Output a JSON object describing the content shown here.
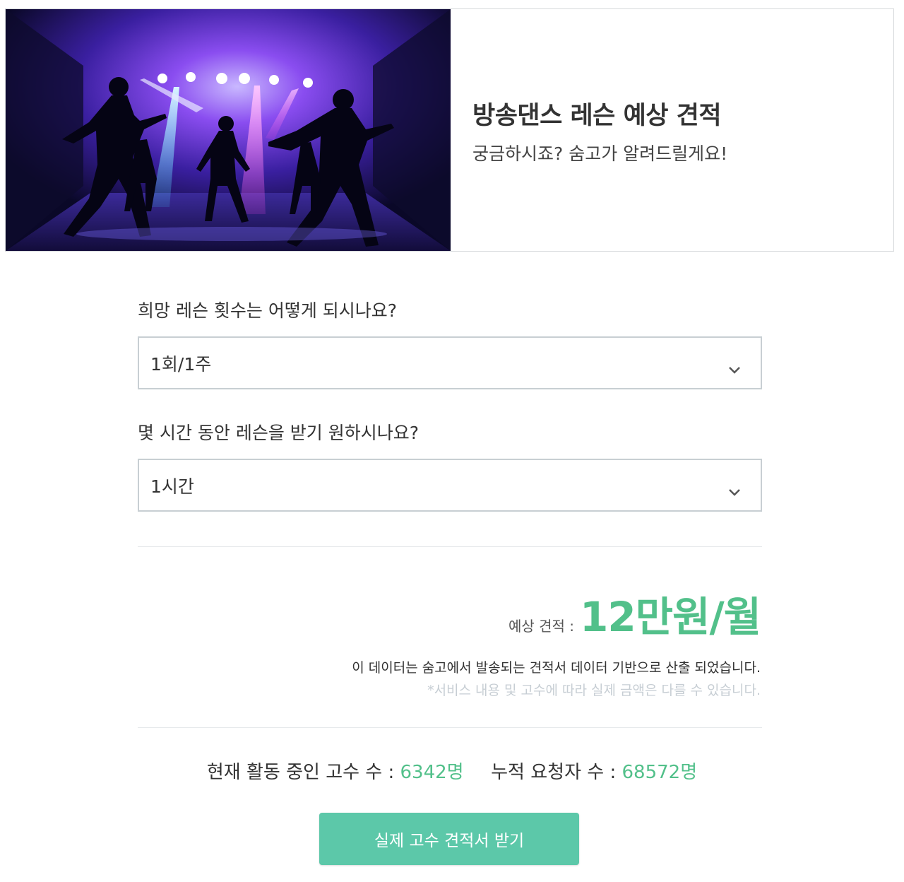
{
  "hero": {
    "title": "방송댄스 레슨 예상 견적",
    "subtitle": "궁금하시죠? 숨고가 알려드릴게요!"
  },
  "questions": [
    {
      "label": "희망 레슨 횟수는 어떻게 되시나요?",
      "selected": "1회/1주"
    },
    {
      "label": "몇 시간 동안 레슨을 받기 원하시나요?",
      "selected": "1시간"
    }
  ],
  "estimate": {
    "label": "예상 견적 :",
    "value": "12만원/월"
  },
  "notes": {
    "source": "이 데이터는 숨고에서 발송되는 견적서 데이터 기반으로 산출 되었습니다.",
    "disclaimer": "*서비스 내용 및 고수에 따라 실제 금액은 다를 수 있습니다."
  },
  "stats": {
    "active_label": "현재 활동 중인 고수 수 :",
    "active_value": "6342명",
    "requests_label": "누적 요청자 수 :",
    "requests_value": "68572명"
  },
  "cta": {
    "label": "실제 고수 견적서 받기"
  },
  "colors": {
    "accent": "#52c08a",
    "button": "#5cc8a9",
    "border": "#c8cfd3"
  }
}
